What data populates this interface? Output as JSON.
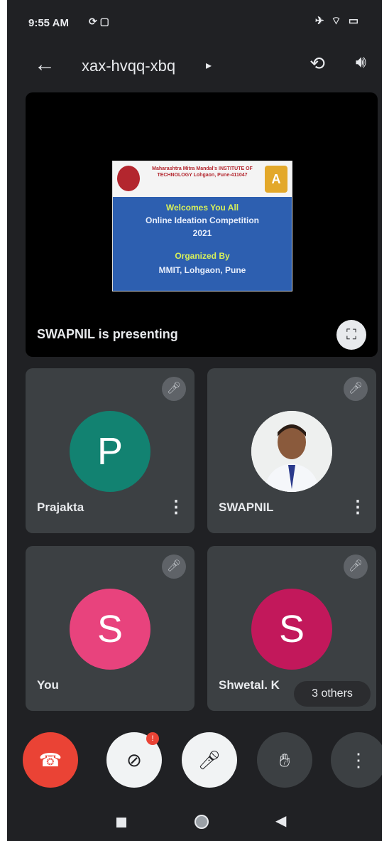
{
  "status_bar": {
    "time": "9:55 AM",
    "left_icons": "⟳ ▢",
    "right_icons": "✈ ⌔ ▭"
  },
  "header": {
    "meeting_code": "xax-hvqq-xbq",
    "caret": "▸"
  },
  "presentation": {
    "slide": {
      "institution": "Maharashtra Mitra Mandal's INSTITUTE OF TECHNOLOGY Lohgaon, Pune-411047",
      "logo_badge": "A",
      "line1": "Welcomes You All",
      "line2": "Online Ideation Competition",
      "line3": "2021",
      "line4": "Organized By",
      "line5": "MMIT, Lohgaon, Pune"
    },
    "presenter_label": "SWAPNIL is presenting"
  },
  "participants": [
    {
      "name": "Prajakta",
      "initial": "P",
      "color": "#128271",
      "has_menu": true
    },
    {
      "name": "SWAPNIL",
      "initial": "",
      "color": "#eef0ef",
      "has_menu": true
    },
    {
      "name": "You",
      "initial": "S",
      "color": "#e8437d",
      "has_menu": false
    },
    {
      "name": "Shwetal. K",
      "initial": "S",
      "color": "#c2185b",
      "has_menu": false
    }
  ],
  "others_label": "3 others",
  "controls": {
    "camera_badge": "!"
  },
  "colors": {
    "background": "#202124",
    "tile": "#3c4043",
    "end_call": "#ea4335"
  }
}
